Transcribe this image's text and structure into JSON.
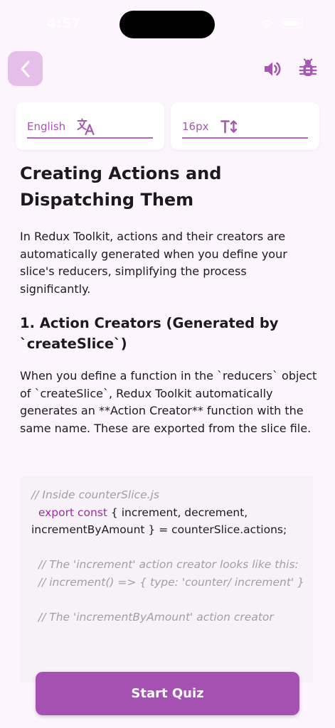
{
  "status_bar": {
    "time": "4:57"
  },
  "header": {
    "back_icon": "chevron-left-icon",
    "sound_icon": "speaker-icon",
    "bug_icon": "bug-icon"
  },
  "selectors": {
    "language": {
      "value": "English",
      "icon": "translate-icon"
    },
    "font_size": {
      "value": "16px",
      "icon": "text-size-icon"
    }
  },
  "content": {
    "title": "Creating Actions and Dispatching Them",
    "intro": "In Redux Toolkit, actions and their creators are automatically generated when you define your slice's reducers, simplifying the process significantly.",
    "section_title": "1. Action Creators (Generated by `createSlice`)",
    "section_body": "When you define a function in the `reducers` object of `createSlice`, Redux Toolkit automatically generates an **Action Creator** function with the same name. These are exported from the slice file."
  },
  "code": {
    "line1": "// Inside counterSlice.js",
    "line2_indent": "  ",
    "line2_keyword": "export const",
    "line2_rest": " { increment, decrement, incrementByAmount } = counterSlice.actions;",
    "line3": "  // The 'increment' action creator looks like this:",
    "line4": "  // increment() => { type: 'counter/ increment' }",
    "line5": "  // The 'incrementByAmount' action creator"
  },
  "footer": {
    "start_quiz_label": "Start Quiz"
  },
  "colors": {
    "accent": "#a451b1",
    "background": "#fdf5fd",
    "back_button_bg": "#e5bfe9",
    "code_keyword": "#a32ca6",
    "code_comment": "#a29fa4"
  }
}
